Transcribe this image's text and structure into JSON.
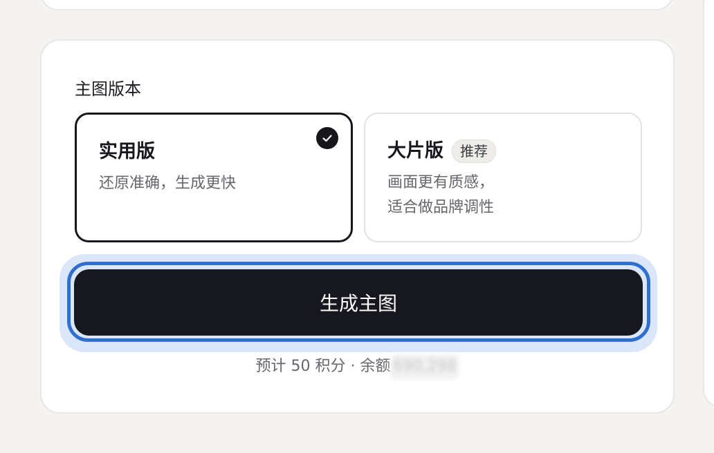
{
  "section": {
    "label": "主图版本"
  },
  "options": [
    {
      "title": "实用版",
      "description_lines": [
        "还原准确，生成更快"
      ],
      "selected": true
    },
    {
      "title": "大片版",
      "tag": "推荐",
      "description_lines": [
        "画面更有质感，",
        "适合做品牌调性"
      ],
      "selected": false
    }
  ],
  "action": {
    "generate_label": "生成主图"
  },
  "cost": {
    "prefix": "预计 50 积分 · 余额",
    "balance": "690,298"
  },
  "colors": {
    "button_bg": "#17181f",
    "focus_ring": "#2f6fd0",
    "focus_halo": "#dbe7f9",
    "selected_border": "#16161c",
    "page_bg": "#f4f3f1"
  },
  "icons": {
    "selected_marker": "check-circle-icon"
  }
}
